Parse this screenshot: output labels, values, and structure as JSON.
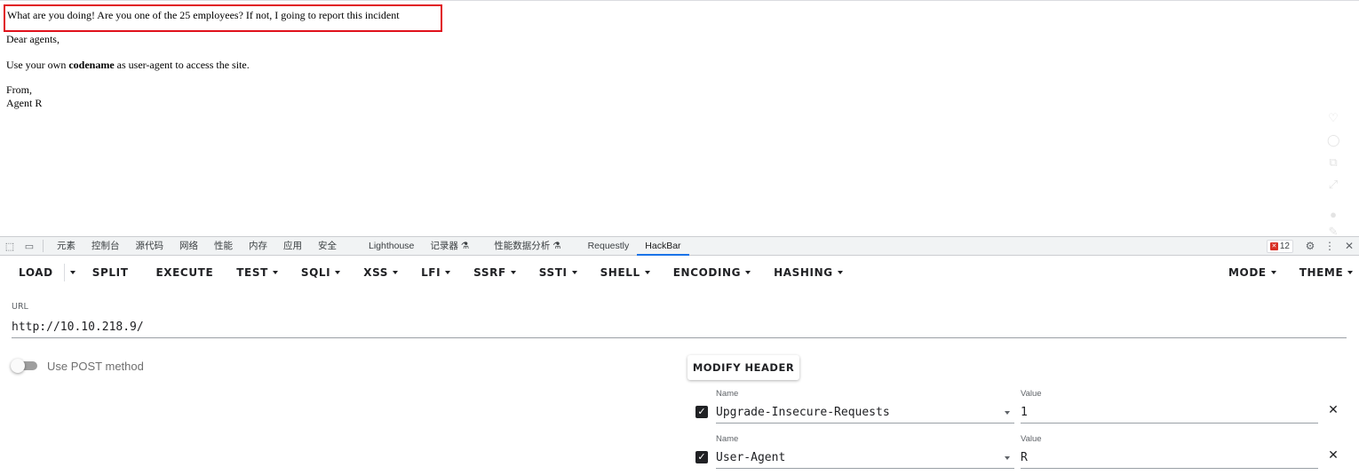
{
  "page": {
    "alert_text": "What are you doing! Are you one of the 25 employees? If not, I going to report this incident",
    "greeting": "Dear agents,",
    "body_prefix": "Use your own ",
    "body_bold": "codename",
    "body_suffix": " as user-agent to access the site.",
    "sign_from": "From,",
    "sign_name": "Agent R",
    "alert_border_color": "#e0111b"
  },
  "devtools": {
    "tabs": [
      "元素",
      "控制台",
      "源代码",
      "网络",
      "性能",
      "内存",
      "应用",
      "安全",
      "Lighthouse",
      "记录器 ⚗",
      "性能数据分析 ⚗",
      "Requestly",
      "HackBar"
    ],
    "active_tab": "HackBar",
    "issue_count": "12"
  },
  "hackbar": {
    "menu": {
      "load": "LOAD",
      "split": "SPLIT",
      "execute": "EXECUTE",
      "test": "TEST",
      "sqli": "SQLI",
      "xss": "XSS",
      "lfi": "LFI",
      "ssrf": "SSRF",
      "ssti": "SSTI",
      "shell": "SHELL",
      "encoding": "ENCODING",
      "hashing": "HASHING",
      "mode": "MODE",
      "theme": "THEME"
    },
    "url_label": "URL",
    "url_value": "http://10.10.218.9/",
    "post_label": "Use POST method",
    "post_enabled": false,
    "modify_header_label": "MODIFY HEADER",
    "headers": [
      {
        "name_label": "Name",
        "name": "Upgrade-Insecure-Requests",
        "value_label": "Value",
        "value": "1",
        "enabled": true
      },
      {
        "name_label": "Name",
        "name": "User-Agent",
        "value_label": "Value",
        "value": "R",
        "enabled": true
      }
    ],
    "accent_color": "#1a73e8"
  }
}
